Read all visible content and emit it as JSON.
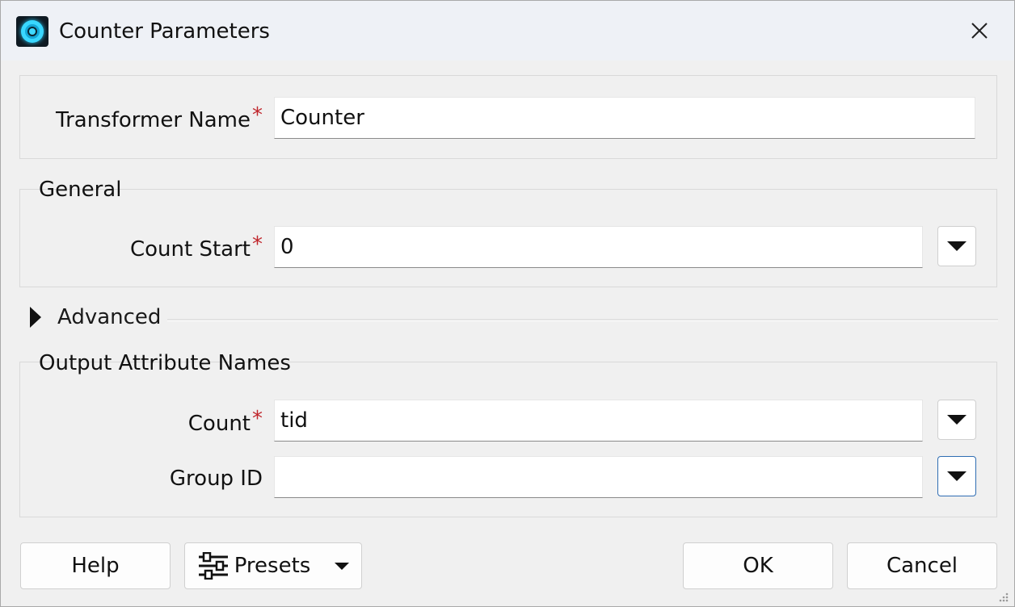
{
  "window": {
    "title": "Counter Parameters",
    "app_icon": "fme-counter-icon",
    "close_icon": "close-icon"
  },
  "transformer": {
    "label": "Transformer Name",
    "required_mark": "*",
    "value": "Counter"
  },
  "general": {
    "group_title": "General",
    "count_start": {
      "label": "Count Start",
      "required_mark": "*",
      "value": "0"
    }
  },
  "advanced": {
    "label": "Advanced",
    "expanded": false
  },
  "output": {
    "group_title": "Output Attribute Names",
    "count": {
      "label": "Count",
      "required_mark": "*",
      "value": "tid"
    },
    "group_id": {
      "label": "Group ID",
      "value": ""
    }
  },
  "buttons": {
    "help": "Help",
    "presets": "Presets",
    "ok": "OK",
    "cancel": "Cancel"
  }
}
